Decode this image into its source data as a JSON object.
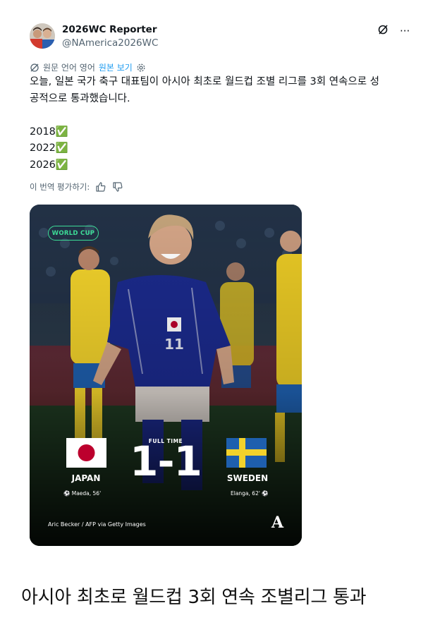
{
  "author": {
    "name": "2026WC Reporter",
    "handle": "@NAmerica2026WC",
    "avatar_icon": "avatar-two-men"
  },
  "header_icons": {
    "grok_icon": "grok-slash-icon",
    "more_label": "···"
  },
  "translation": {
    "note": "원문 언어 영어",
    "show_original": "원본 보기"
  },
  "tweet": {
    "text": "오늘, 일본 국가 축구 대표팀이 아시아 최초로 월드컵 조별 리그를 3회 연속으로 성\n공적으로 통과했습니다.\n\n2018✅\n2022✅\n2026✅"
  },
  "rate": {
    "label": "이 번역 평가하기:"
  },
  "media": {
    "badge": "WORLD CUP",
    "full_time": "FULL TIME",
    "score": "1-1",
    "team_left": "JAPAN",
    "team_right": "SWEDEN",
    "scorer_left": "Maeda, 56'",
    "scorer_right": "Elanga, 62'",
    "credit": "Aric Becker / AFP via Getty Images",
    "logo": "A",
    "player_number": "11",
    "colors": {
      "japan_blue": "#1b2a8c",
      "sweden_yellow": "#f2d22b",
      "sweden_blue": "#1e5fae",
      "japan_red": "#bc002d",
      "badge_green": "#3ddc97"
    }
  },
  "headline": "아시아 최초로 월드컵 3회 연속 조별리그 통과"
}
